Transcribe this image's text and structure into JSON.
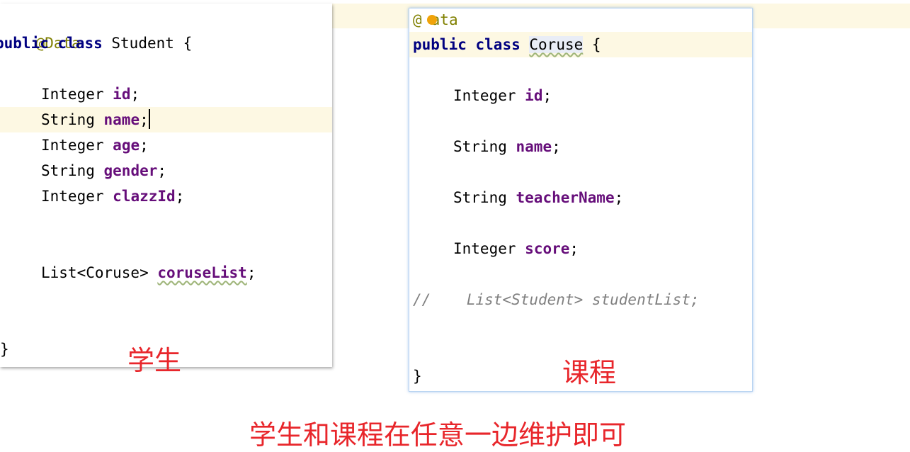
{
  "student": {
    "annotation": "@Data",
    "kw_public": "public",
    "kw_class": "class",
    "class_name": "Student",
    "brace_open": "{",
    "fields": [
      {
        "type": "Integer",
        "name": "id",
        "semi": ";"
      },
      {
        "type": "String",
        "name": "name",
        "semi": ";"
      },
      {
        "type": "Integer",
        "name": "age",
        "semi": ";"
      },
      {
        "type": "String",
        "name": "gender",
        "semi": ";"
      },
      {
        "type": "Integer",
        "name": "clazzId",
        "semi": ";"
      }
    ],
    "list_type": "List<Coruse>",
    "list_name": "coruseList",
    "list_semi": ";",
    "brace_close": "}",
    "caption": "学生"
  },
  "course": {
    "annotation_prefix": "@",
    "annotation_rest": "ata",
    "kw_public": "public",
    "kw_class": "class",
    "class_name": "Coruse",
    "brace_open": "{",
    "fields": [
      {
        "type": "Integer",
        "name": "id",
        "semi": ";"
      },
      {
        "type": "String",
        "name": "name",
        "semi": ";"
      },
      {
        "type": "String",
        "name": "teacherName",
        "semi": ";"
      },
      {
        "type": "Integer",
        "name": "score",
        "semi": ";"
      }
    ],
    "comment": "//    List<Student> studentList;",
    "brace_close": "}",
    "caption": "课程"
  },
  "footer_caption": "学生和课程在任意一边维护即可",
  "colors": {
    "keyword": "#000080",
    "annotation": "#808000",
    "field": "#660e7a",
    "comment": "#808080",
    "caption": "#e8262b",
    "current_line": "#fdf8e3"
  }
}
